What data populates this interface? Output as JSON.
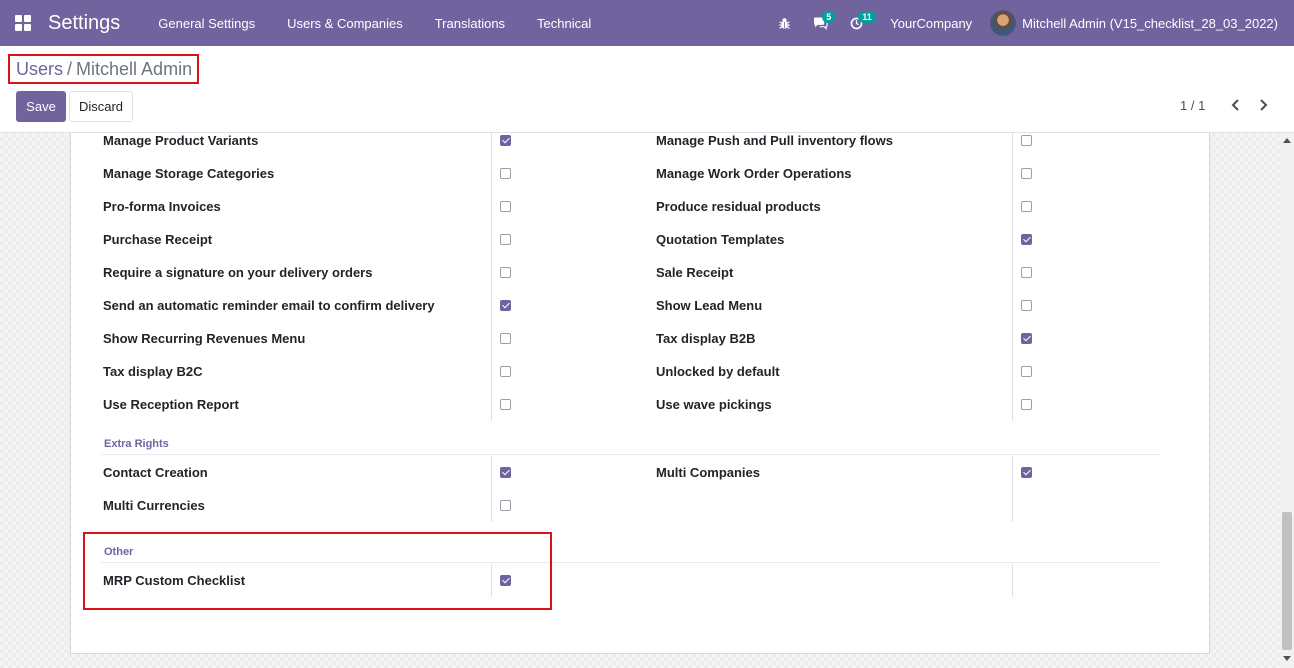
{
  "navbar": {
    "app_title": "Settings",
    "menu": [
      "General Settings",
      "Users & Companies",
      "Translations",
      "Technical"
    ],
    "debug_icon": "bug-icon",
    "messages_icon": "chat-icon",
    "messages_count": "5",
    "activities_icon": "clock-icon",
    "activities_count": "11",
    "company": "YourCompany",
    "user": "Mitchell Admin (V15_checklist_28_03_2022)"
  },
  "breadcrumb": {
    "parent": "Users",
    "separator": "/",
    "current": "Mitchell Admin"
  },
  "buttons": {
    "save": "Save",
    "discard": "Discard"
  },
  "pager": {
    "value": "1 / 1",
    "prev_icon": "chevron-left-icon",
    "next_icon": "chevron-right-icon"
  },
  "rights_rows": [
    {
      "left": {
        "label": "Manage Product Variants",
        "checked": true
      },
      "right": {
        "label": "Manage Push and Pull inventory flows",
        "checked": false
      }
    },
    {
      "left": {
        "label": "Manage Storage Categories",
        "checked": false
      },
      "right": {
        "label": "Manage Work Order Operations",
        "checked": false
      }
    },
    {
      "left": {
        "label": "Pro-forma Invoices",
        "checked": false
      },
      "right": {
        "label": "Produce residual products",
        "checked": false
      }
    },
    {
      "left": {
        "label": "Purchase Receipt",
        "checked": false
      },
      "right": {
        "label": "Quotation Templates",
        "checked": true
      }
    },
    {
      "left": {
        "label": "Require a signature on your delivery orders",
        "checked": false
      },
      "right": {
        "label": "Sale Receipt",
        "checked": false
      }
    },
    {
      "left": {
        "label": "Send an automatic reminder email to confirm delivery",
        "checked": true
      },
      "right": {
        "label": "Show Lead Menu",
        "checked": false
      }
    },
    {
      "left": {
        "label": "Show Recurring Revenues Menu",
        "checked": false
      },
      "right": {
        "label": "Tax display B2B",
        "checked": true
      }
    },
    {
      "left": {
        "label": "Tax display B2C",
        "checked": false
      },
      "right": {
        "label": "Unlocked by default",
        "checked": false
      }
    },
    {
      "left": {
        "label": "Use Reception Report",
        "checked": false
      },
      "right": {
        "label": "Use wave pickings",
        "checked": false
      }
    }
  ],
  "extra_rights": {
    "title": "Extra Rights",
    "rows": [
      {
        "left": {
          "label": "Contact Creation",
          "checked": true
        },
        "right": {
          "label": "Multi Companies",
          "checked": true
        }
      },
      {
        "left": {
          "label": "Multi Currencies",
          "checked": false
        }
      }
    ]
  },
  "other": {
    "title": "Other",
    "rows": [
      {
        "left": {
          "label": "MRP Custom Checklist",
          "checked": true
        }
      }
    ]
  },
  "colors": {
    "brand": "#71639e",
    "highlight": "#d9131b"
  }
}
